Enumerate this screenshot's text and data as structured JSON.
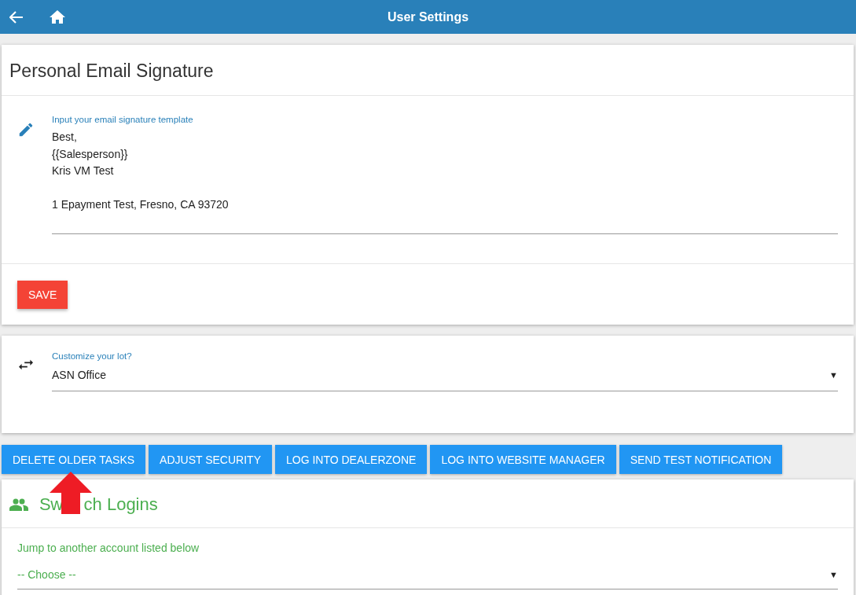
{
  "top_bar": {
    "title": "User Settings"
  },
  "signature_card": {
    "title": "Personal Email Signature",
    "field": {
      "label": "Input your email signature template",
      "value": "Best,\n{{Salesperson}}\nKris VM Test\n\n1 Epayment Test, Fresno, CA 93720"
    },
    "save_button": "SAVE"
  },
  "lot_card": {
    "field": {
      "label": "Customize your lot?",
      "value": "ASN Office",
      "caret": "▼"
    }
  },
  "actions": [
    {
      "label": "DELETE OLDER TASKS"
    },
    {
      "label": "ADJUST SECURITY"
    },
    {
      "label": "LOG INTO DEALERZONE"
    },
    {
      "label": "LOG INTO WEBSITE MANAGER"
    },
    {
      "label": "SEND TEST NOTIFICATION"
    }
  ],
  "switch_card": {
    "title_parts": [
      "Sw",
      "ch Logins"
    ],
    "label": "Jump to another account listed below",
    "select": {
      "value": "-- Choose --",
      "caret": "▼"
    }
  }
}
